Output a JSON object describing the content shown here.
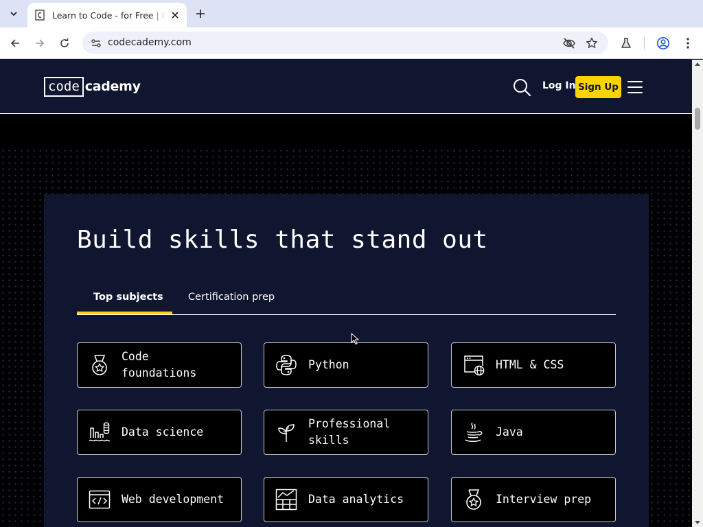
{
  "browser": {
    "tab_title": "Learn to Code - for Free | Codecademy",
    "url": "codecademy.com"
  },
  "header": {
    "logo_boxed": "code",
    "logo_rest": "cademy",
    "login_label": "Log In",
    "signup_label": "Sign Up",
    "colors": {
      "background": "#10162f",
      "accent": "#ffd300"
    }
  },
  "main": {
    "headline": "Build skills that stand out",
    "tabs": [
      {
        "label": "Top subjects",
        "active": true
      },
      {
        "label": "Certification prep",
        "active": false
      }
    ],
    "subjects": [
      {
        "label": "Code foundations",
        "icon": "medal-star-icon"
      },
      {
        "label": "Python",
        "icon": "python-icon"
      },
      {
        "label": "HTML & CSS",
        "icon": "browser-globe-icon"
      },
      {
        "label": "Data science",
        "icon": "bar-chart-database-icon"
      },
      {
        "label": "Professional skills",
        "icon": "sprout-icon"
      },
      {
        "label": "Java",
        "icon": "coffee-cup-icon"
      },
      {
        "label": "Web development",
        "icon": "code-window-icon"
      },
      {
        "label": "Data analytics",
        "icon": "spreadsheet-chart-icon"
      },
      {
        "label": "Interview prep",
        "icon": "medal-star-icon"
      }
    ]
  }
}
